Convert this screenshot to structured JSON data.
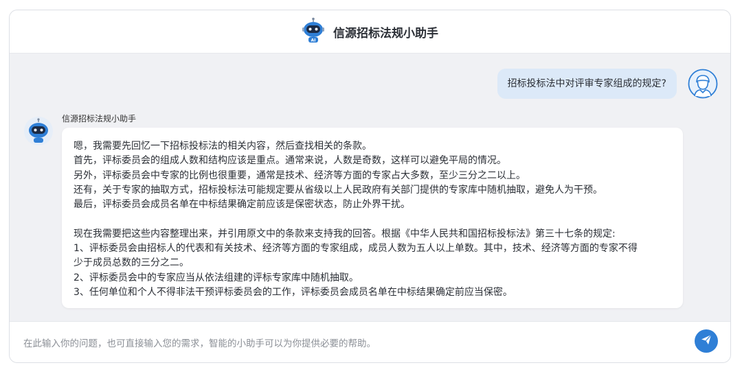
{
  "header": {
    "title": "信源招标法规小助手",
    "logo_icon": "robot-ai-icon",
    "logo_badge": "AI"
  },
  "conversation": {
    "user_message": "招标投标法中对评审专家组成的规定?",
    "user_avatar_icon": "user-avatar-icon",
    "bot_name": "信源招标法规小助手",
    "bot_avatar_icon": "robot-avatar-icon",
    "bot_reply": {
      "thinking_lines": [
        "嗯，我需要先回忆一下招标投标法的相关内容，然后查找相关的条款。",
        "首先，评标委员会的组成人数和结构应该是重点。通常来说，人数是奇数，这样可以避免平局的情况。",
        "另外，评标委员会中专家的比例也很重要，通常是技术、经济等方面的专家占大多数，至少三分之二以上。",
        "还有，关于专家的抽取方式，招标投标法可能规定要从省级以上人民政府有关部门提供的专家库中随机抽取，避免人为干预。",
        "最后，评标委员会成员名单在中标结果确定前应该是保密状态，防止外界干扰。"
      ],
      "answer_lines": [
        "现在我需要把这些内容整理出来，并引用原文中的条款来支持我的回答。根据《中华人民共和国招标投标法》第三十七条的规定:",
        "1、评标委员会由招标人的代表和有关技术、经济等方面的专家组成，成员人数为五人以上单数。其中，技术、经济等方面的专家不得",
        "少于成员总数的三分之二。",
        "2、评标委员会中的专家应当从依法组建的评标专家库中随机抽取。",
        "3、任何单位和个人不得非法干预评标委员会的工作，评标委员会成员名单在中标结果确定前应当保密。"
      ]
    }
  },
  "input": {
    "placeholder": "在此输入你的问题，也可直接输入您的需求，智能的小助手可以为你提供必要的帮助。",
    "send_icon": "send-paper-plane-icon"
  },
  "colors": {
    "accent": "#2f7fd6",
    "user_bubble": "#dce9f8",
    "chat_background": "#f0f1f4"
  }
}
